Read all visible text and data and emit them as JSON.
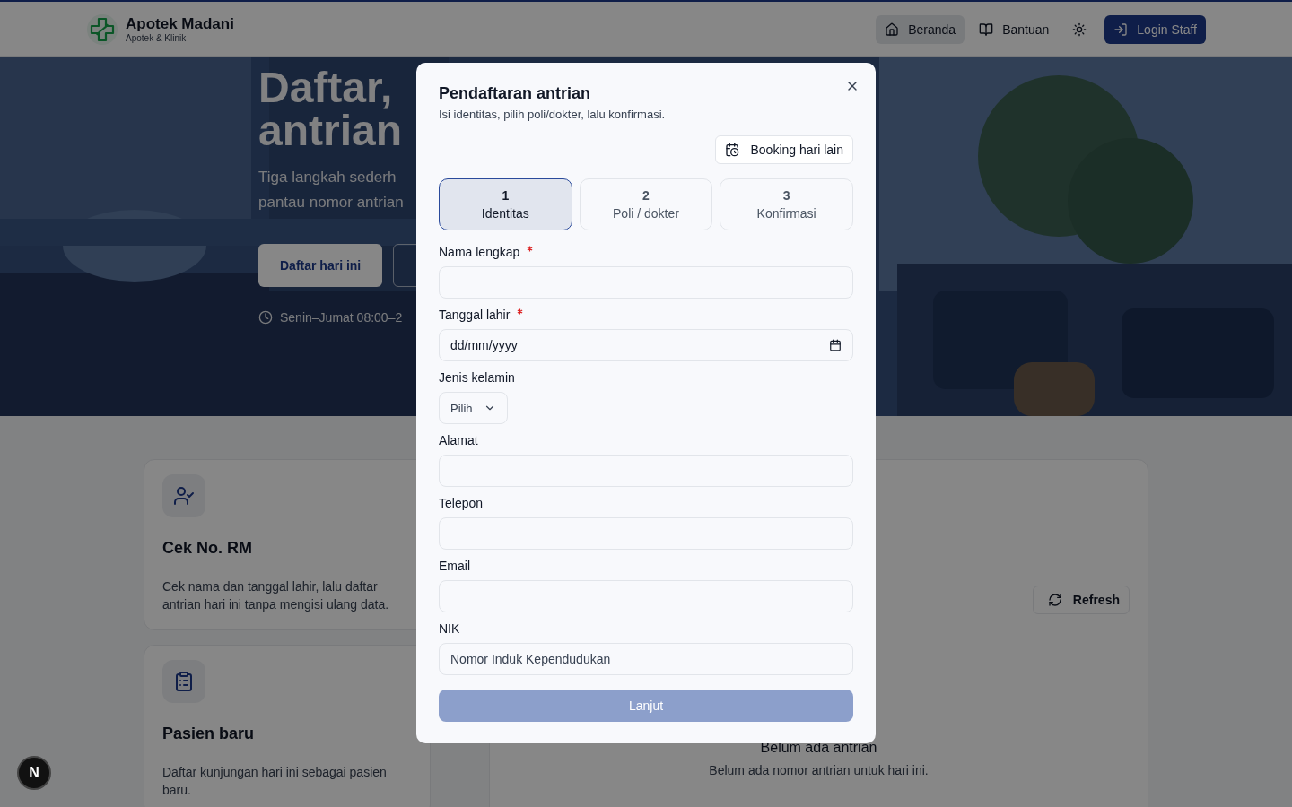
{
  "header": {
    "brand": {
      "name": "Apotek Madani",
      "tagline": "Apotek & Klinik"
    },
    "nav": [
      {
        "label": "Beranda",
        "selected": true
      },
      {
        "label": "Bantuan",
        "selected": false
      }
    ],
    "login_button": "Login Staff"
  },
  "hero": {
    "title_lines": [
      "Daftar,",
      "antrian"
    ],
    "subtitle_lines": [
      "Tiga langkah sederh",
      "pantau nomor antrian"
    ],
    "primary_button": "Daftar hari ini",
    "hours": "Senin–Jumat 08:00–2"
  },
  "cards": [
    {
      "title": "Cek No. RM",
      "description": "Cek nama dan tanggal lahir, lalu daftar antrian hari ini tanpa mengisi ulang data."
    },
    {
      "title": "Pasien baru",
      "description": "Daftar kunjungan hari ini sebagai pasien baru."
    }
  ],
  "queue_panel": {
    "refresh_button": "Refresh",
    "empty_title": "Belum ada antrian",
    "empty_text": "Belum ada nomor antrian untuk hari ini."
  },
  "dialog": {
    "title": "Pendaftaran antrian",
    "subtitle": "Isi identitas, pilih poli/dokter, lalu konfirmasi.",
    "booking_button": "Booking hari lain",
    "steps": [
      {
        "number": "1",
        "label": "Identitas",
        "selected": true
      },
      {
        "number": "2",
        "label": "Poli / dokter",
        "selected": false
      },
      {
        "number": "3",
        "label": "Konfirmasi",
        "selected": false
      }
    ],
    "fields": [
      {
        "kind": "text",
        "label": "Nama lengkap",
        "required": true
      },
      {
        "kind": "date",
        "label": "Tanggal lahir",
        "required": true,
        "value": "dd/mm/yyyy"
      },
      {
        "kind": "select",
        "label": "Jenis kelamin",
        "required": false,
        "value": "Pilih"
      },
      {
        "kind": "text",
        "label": "Alamat",
        "required": false
      },
      {
        "kind": "text",
        "label": "Telepon",
        "required": false
      },
      {
        "kind": "text",
        "label": "Email",
        "required": false
      },
      {
        "kind": "text",
        "label": "NIK",
        "required": false,
        "placeholder": "Nomor Induk Kependudukan"
      }
    ],
    "submit": {
      "label": "Lanjut",
      "disabled": true
    }
  },
  "dev_badge": "N"
}
